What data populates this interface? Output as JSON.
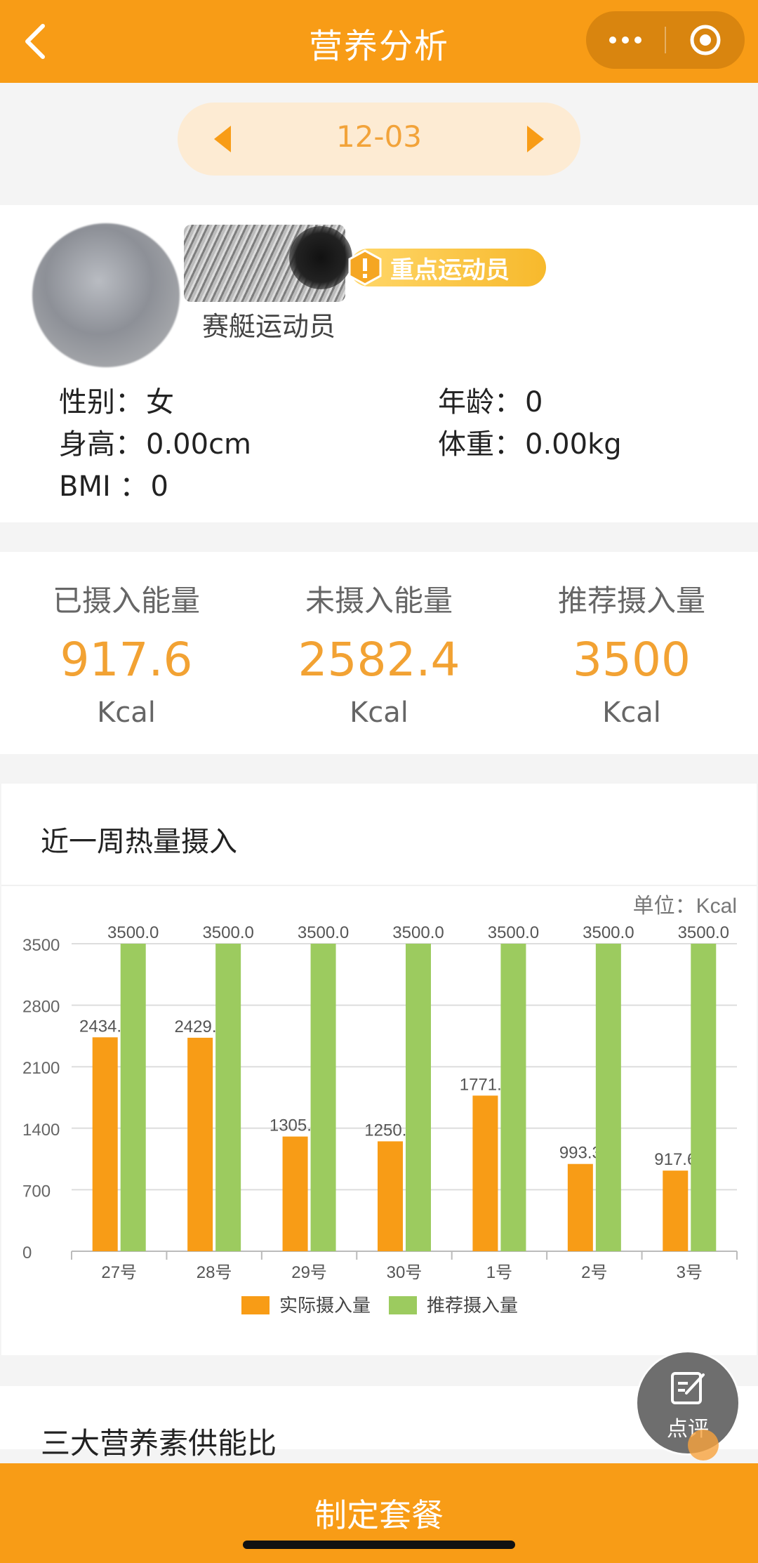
{
  "header": {
    "title": "营养分析",
    "accent_color": "#f89c16",
    "icons": {
      "back": "chevron-left-icon",
      "more": "more-dots-icon",
      "close": "target-close-icon"
    }
  },
  "date_nav": {
    "date": "12-03",
    "prev_icon": "triangle-left-icon",
    "next_icon": "triangle-right-icon"
  },
  "profile": {
    "badge": "重点运动员",
    "sport": "赛艇运动员",
    "gender": {
      "label": "性别：",
      "value": "女"
    },
    "age": {
      "label": "年龄：",
      "value": "0"
    },
    "height": {
      "label": "身高：",
      "value": "0.00cm"
    },
    "weight": {
      "label": "体重：",
      "value": "0.00kg"
    },
    "bmi": {
      "label": "BMI ：",
      "value": "0"
    }
  },
  "energy": [
    {
      "label": "已摄入能量",
      "value": "917.6",
      "unit": "Kcal"
    },
    {
      "label": "未摄入能量",
      "value": "2582.4",
      "unit": "Kcal"
    },
    {
      "label": "推荐摄入量",
      "value": "3500",
      "unit": "Kcal"
    }
  ],
  "week_card": {
    "title": "近一周热量摄入"
  },
  "chart_data": {
    "type": "bar",
    "unit_label": "单位：Kcal",
    "categories": [
      "27号",
      "28号",
      "29号",
      "30号",
      "1号",
      "2号",
      "3号"
    ],
    "series": [
      {
        "name": "实际摄入量",
        "color": "#f89c16",
        "values": [
          2434.7,
          2429.8,
          1305.5,
          1250.9,
          1771.2,
          993.3,
          917.6
        ]
      },
      {
        "name": "推荐摄入量",
        "color": "#9ccb5f",
        "values": [
          3500.0,
          3500.0,
          3500.0,
          3500.0,
          3500.0,
          3500.0,
          3500.0
        ]
      }
    ],
    "yticks": [
      0,
      700,
      1400,
      2100,
      2800,
      3500
    ],
    "ylim": [
      0,
      3500
    ],
    "grid": true,
    "legend": "bottom"
  },
  "nutrients_card": {
    "title": "三大营养素供能比"
  },
  "comment": {
    "label": "点评",
    "icon": "edit-note-icon"
  },
  "bottom": {
    "button": "制定套餐"
  }
}
